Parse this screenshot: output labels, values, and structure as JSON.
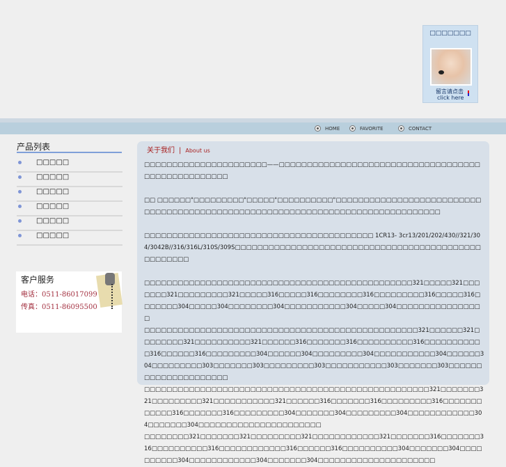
{
  "widget": {
    "title": "□□□□□□□",
    "line1": "留言请点击",
    "line2": "click here"
  },
  "nav": [
    {
      "label": "HOME"
    },
    {
      "label": "FAVORITE"
    },
    {
      "label": "CONTACT"
    }
  ],
  "sidebar": {
    "title": "产品列表",
    "items": [
      {
        "label": "□□□□□"
      },
      {
        "label": "□□□□□"
      },
      {
        "label": "□□□□□"
      },
      {
        "label": "□□□□□"
      },
      {
        "label": "□□□□□"
      },
      {
        "label": "□□□□□"
      }
    ]
  },
  "service": {
    "title": "客户服务",
    "phone": "电话：0511-86017099",
    "fax": "传真：0511-86095500"
  },
  "main": {
    "title_cn": "关于我们",
    "divider": "|",
    "title_en": "About us",
    "paragraphs": [
      "□□□□□□□□□□□□□□□□□□□□□□——□□□□□□□□□□□□□□□□□□□□□□□□□□□□□□□□□□□□□□□□□□□□□□□□□□□",
      "□□ □□□□□□\"□□□□□□□□□\"□□□□□\"□□□□□□□□□□\"□□□□□□□□□□□□□□□□□□□□□□□□□□□□□□□□□□□□□□□□□□□□□□□□□□□□□□□□□□□□□□□□□□□□□□□□□□□□□□□",
      "□□□□□□□□□□□□□□□□□□□□□□□□□□□□□□□□□□□□□□□□□ 1CR13- 3cr13/201/202/430//321/304/3042B//316/316L/310S/309S□□□□□□□□□□□□□□□□□□□□□□□□□□□□□□□□□□□□□□□□□□□□□□□□□□□□",
      "□□□□□□□□□□□□□□□□□□□□□□□□□□□□□□□□□□□□□□□□□□□□□□□□321□□□□□321□□□□□□□321□□□□□□□□□321□□□□□316□□□□□316□□□□□□□□316□□□□□□□□□316□□□□□316□□□□□□□304□□□□□304□□□□□□□□304□□□□□□□□□□□304□□□□□304□□□□□□□□□□□□□□□□",
      "□□□□□□□□□□□□□□□□□□□□□□□□□□□□□□□□□□□□□□□□□□□□□□□□□321□□□□□□321□□□□□□□□321□□□□□□□□□□321□□□□□□316□□□□□□□316□□□□□□□□□□316□□□□□□□□□□□316□□□□□□316□□□□□□□□□304□□□□□□304□□□□□□□□□304□□□□□□□□□□□304□□□□□□304□□□□□□□□□303□□□□□□□303□□□□□□□□□303□□□□□□□□□□□303□□□□□□□303□□□□□□□□□□□□□□□□□□□□□",
      "□□□□□□□□□□□□□□□□□□□□□□□□□□□□□□□□□□□□□□□□□□□□□□□□□□□321□□□□□□□321□□□□□□□□□321□□□□□□□□□□□321□□□□□□316□□□□□□□316□□□□□□□□□316□□□□□□□□□□□□316□□□□□□□316□□□□□□□□□304□□□□□□□304□□□□□□□□□304□□□□□□□□□□□□304□□□□□□□304□□□□□□□□□□□□□□□□□□□□□□",
      "□□□□□□□□321□□□□□□□321□□□□□□□□□321□□□□□□□□□□□□321□□□□□□□316□□□□□□□316□□□□□□□□□□316□□□□□□□□□□□□316□□□□□□316□□□□□□□□□□304□□□□□□□304□□□□□□□□□□304□□□□□□□□□□□□304□□□□□□□304□□□□□□□□□□□□□□□□□□□□□"
    ]
  }
}
